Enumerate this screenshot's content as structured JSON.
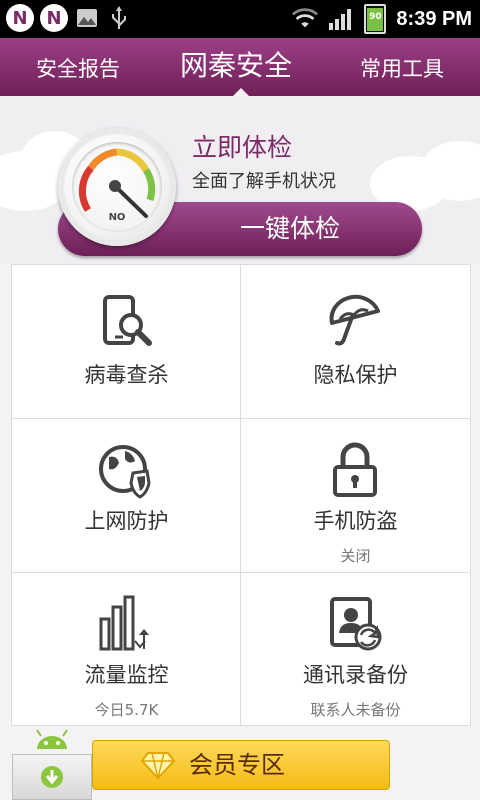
{
  "status_bar": {
    "notification_icons": [
      "n-notification-icon",
      "n-notification-icon",
      "gallery-icon",
      "usb-icon"
    ],
    "badge_letter": "N",
    "battery_level": "90",
    "time": "8:39 PM"
  },
  "header": {
    "tab_left": "安全报告",
    "tab_center": "网秦安全",
    "tab_right": "常用工具"
  },
  "hero": {
    "title": "立即体检",
    "subtitle": "全面了解手机状况",
    "gauge_label": "NO",
    "scan_button": "一键体检"
  },
  "grid": {
    "items": [
      {
        "label": "病毒查杀",
        "sub": "",
        "icon": "phone-search-icon"
      },
      {
        "label": "隐私保护",
        "sub": "",
        "icon": "umbrella-icon"
      },
      {
        "label": "上网防护",
        "sub": "",
        "icon": "globe-shield-icon"
      },
      {
        "label": "手机防盗",
        "sub": "关闭",
        "icon": "lock-icon"
      },
      {
        "label": "流量监控",
        "sub": "今日5.7K",
        "icon": "traffic-bars-icon"
      },
      {
        "label": "通讯录备份",
        "sub": "联系人未备份",
        "icon": "contacts-backup-icon"
      }
    ]
  },
  "bottom": {
    "vip_button": "会员专区"
  },
  "colors": {
    "brand": "#7a2a68",
    "vip": "#f4bb16"
  }
}
